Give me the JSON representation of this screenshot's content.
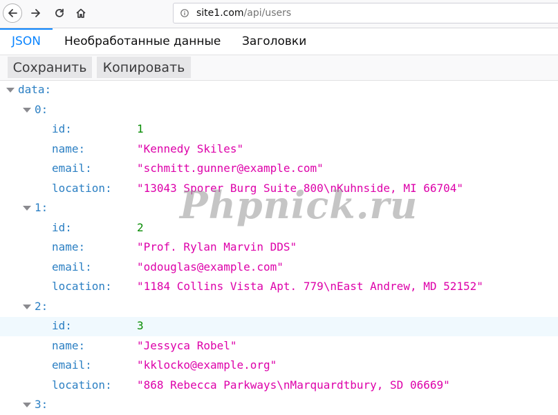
{
  "browser": {
    "url_host": "site1.com",
    "url_path": "/api/users"
  },
  "tabs": [
    {
      "label": "JSON",
      "active": true
    },
    {
      "label": "Необработанные данные",
      "active": false
    },
    {
      "label": "Заголовки",
      "active": false
    }
  ],
  "toolbar": {
    "save_label": "Сохранить",
    "copy_label": "Копировать"
  },
  "tree": {
    "root_key": "data:",
    "items": [
      {
        "index_label": "0:",
        "fields": [
          {
            "key": "id:",
            "value": "1",
            "type": "num"
          },
          {
            "key": "name:",
            "value": "\"Kennedy Skiles\"",
            "type": "str"
          },
          {
            "key": "email:",
            "value": "\"schmitt.gunner@example.com\"",
            "type": "str"
          },
          {
            "key": "location:",
            "value": "\"13043 Sporer Burg Suite 800\\nKuhnside, MI 66704\"",
            "type": "str"
          }
        ]
      },
      {
        "index_label": "1:",
        "fields": [
          {
            "key": "id:",
            "value": "2",
            "type": "num"
          },
          {
            "key": "name:",
            "value": "\"Prof. Rylan Marvin DDS\"",
            "type": "str"
          },
          {
            "key": "email:",
            "value": "\"odouglas@example.com\"",
            "type": "str"
          },
          {
            "key": "location:",
            "value": "\"1184 Collins Vista Apt. 779\\nEast Andrew, MD 52152\"",
            "type": "str"
          }
        ]
      },
      {
        "index_label": "2:",
        "fields": [
          {
            "key": "id:",
            "value": "3",
            "type": "num",
            "highlighted": true
          },
          {
            "key": "name:",
            "value": "\"Jessyca Robel\"",
            "type": "str"
          },
          {
            "key": "email:",
            "value": "\"kklocko@example.org\"",
            "type": "str"
          },
          {
            "key": "location:",
            "value": "\"868 Rebecca Parkways\\nMarquardtbury, SD 06669\"",
            "type": "str"
          }
        ]
      },
      {
        "index_label": "3:",
        "fields": []
      }
    ]
  },
  "watermark": "Phpnick.ru",
  "colors": {
    "key": "#2b7fc3",
    "string": "#dd00a9",
    "number": "#058b00",
    "active_tab": "#0a84ff"
  }
}
